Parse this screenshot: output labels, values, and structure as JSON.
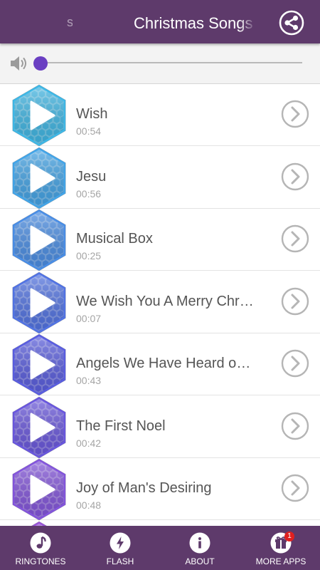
{
  "header": {
    "title": "Christmas Songs",
    "marquee_ghost": "s",
    "share_icon": "share-icon"
  },
  "volume": {
    "icon": "speaker-icon",
    "level": 0
  },
  "songs": [
    {
      "title": "Wish",
      "duration": "00:54",
      "color": "#3fb9e8"
    },
    {
      "title": "Jesu",
      "duration": "00:56",
      "color": "#43a6ea"
    },
    {
      "title": "Musical Box",
      "duration": "00:25",
      "color": "#4a8fe8"
    },
    {
      "title": "We Wish You A Merry Christ...",
      "duration": "00:07",
      "color": "#5274e6"
    },
    {
      "title": "Angels We Have Heard on...",
      "duration": "00:43",
      "color": "#5a5ee2"
    },
    {
      "title": "The First Noel",
      "duration": "00:42",
      "color": "#6a57e0"
    },
    {
      "title": "Joy of Man's Desiring",
      "duration": "00:48",
      "color": "#8455de"
    },
    {
      "title": "",
      "duration": "",
      "color": "#9a55da"
    }
  ],
  "bottom_nav": {
    "ringtones": "RINGTONES",
    "flash": "FLASH",
    "about": "ABOUT",
    "more_apps": "MORE APPS",
    "more_apps_badge": "1"
  },
  "colors": {
    "bar": "#5e3a6b",
    "accent": "#6a3fc2"
  }
}
